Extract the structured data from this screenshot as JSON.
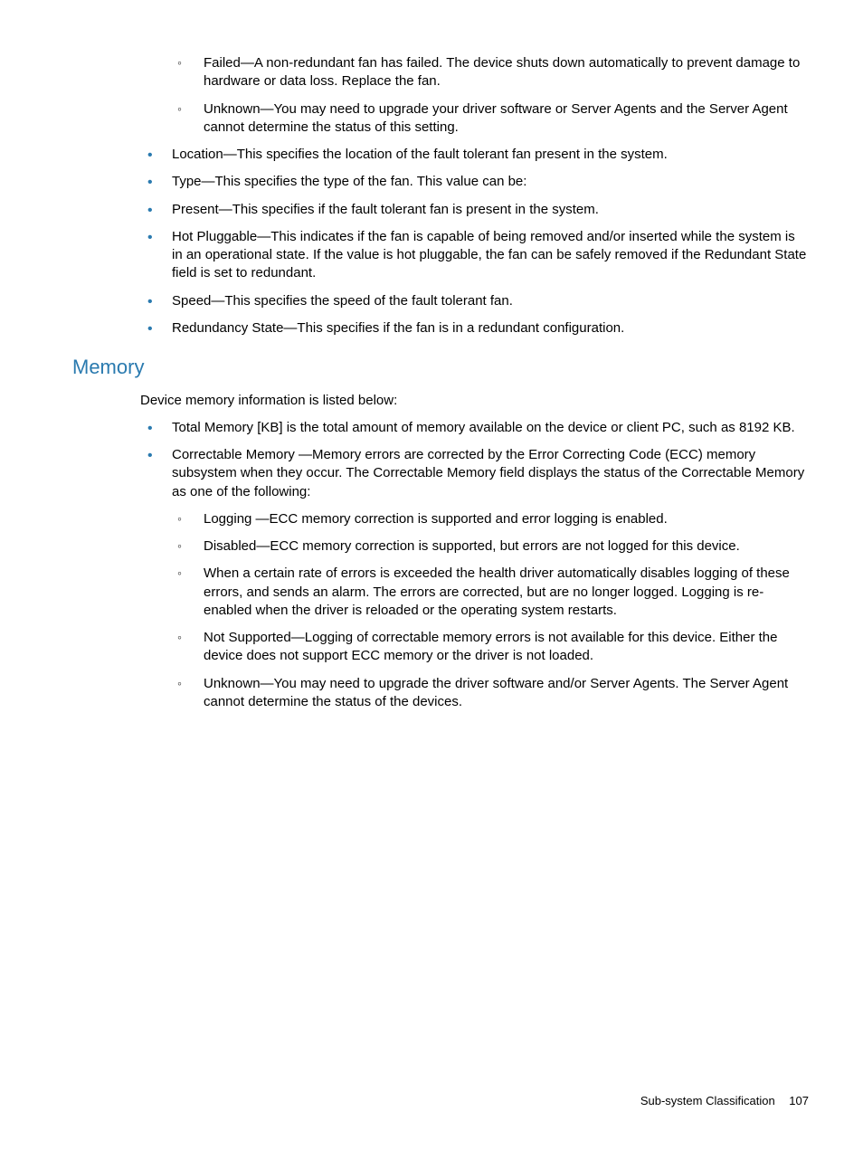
{
  "top_circles": [
    "Failed—A non-redundant fan has failed. The device shuts down automatically to prevent damage to hardware or data loss. Replace the fan.",
    "Unknown—You may need to upgrade your driver software or Server Agents and the Server Agent cannot determine the status of this setting."
  ],
  "top_bullets": [
    "Location—This specifies the location of the fault tolerant fan present in the system.",
    "Type—This specifies the type of the fan. This value can be:",
    "Present—This specifies if the fault tolerant fan is present in the system.",
    "Hot Pluggable—This indicates if the fan is capable of being removed and/or inserted while the system is in an operational state. If the value is hot pluggable, the fan can be safely removed if the Redundant State field is set to redundant.",
    "Speed—This specifies the speed of the fault tolerant fan.",
    "Redundancy State—This specifies if the fan is in a redundant configuration."
  ],
  "section_heading": "Memory",
  "memory_intro": "Device memory information is listed below:",
  "memory_bullets": [
    "Total Memory [KB] is the total amount of memory available on the device or client PC, such as 8192 KB.",
    "Correctable Memory —Memory errors are corrected by the Error Correcting Code (ECC) memory subsystem when they occur. The Correctable Memory field displays the status of the Correctable Memory as one of the following:"
  ],
  "memory_circles": [
    "Logging —ECC memory correction is supported and error logging is enabled.",
    "Disabled—ECC memory correction is supported, but errors are not logged for this device.",
    "When a certain rate of errors is exceeded the health driver automatically disables logging of these errors, and sends an alarm. The errors are corrected, but are no longer logged. Logging is re-enabled when the driver is reloaded or the operating system restarts.",
    "Not Supported—Logging of correctable memory errors is not available for this device. Either the device does not support ECC memory or the driver is not loaded.",
    "Unknown—You may need to upgrade the driver software and/or Server Agents. The Server Agent cannot determine the status of the devices."
  ],
  "footer_text": "Sub-system Classification",
  "footer_page": "107"
}
